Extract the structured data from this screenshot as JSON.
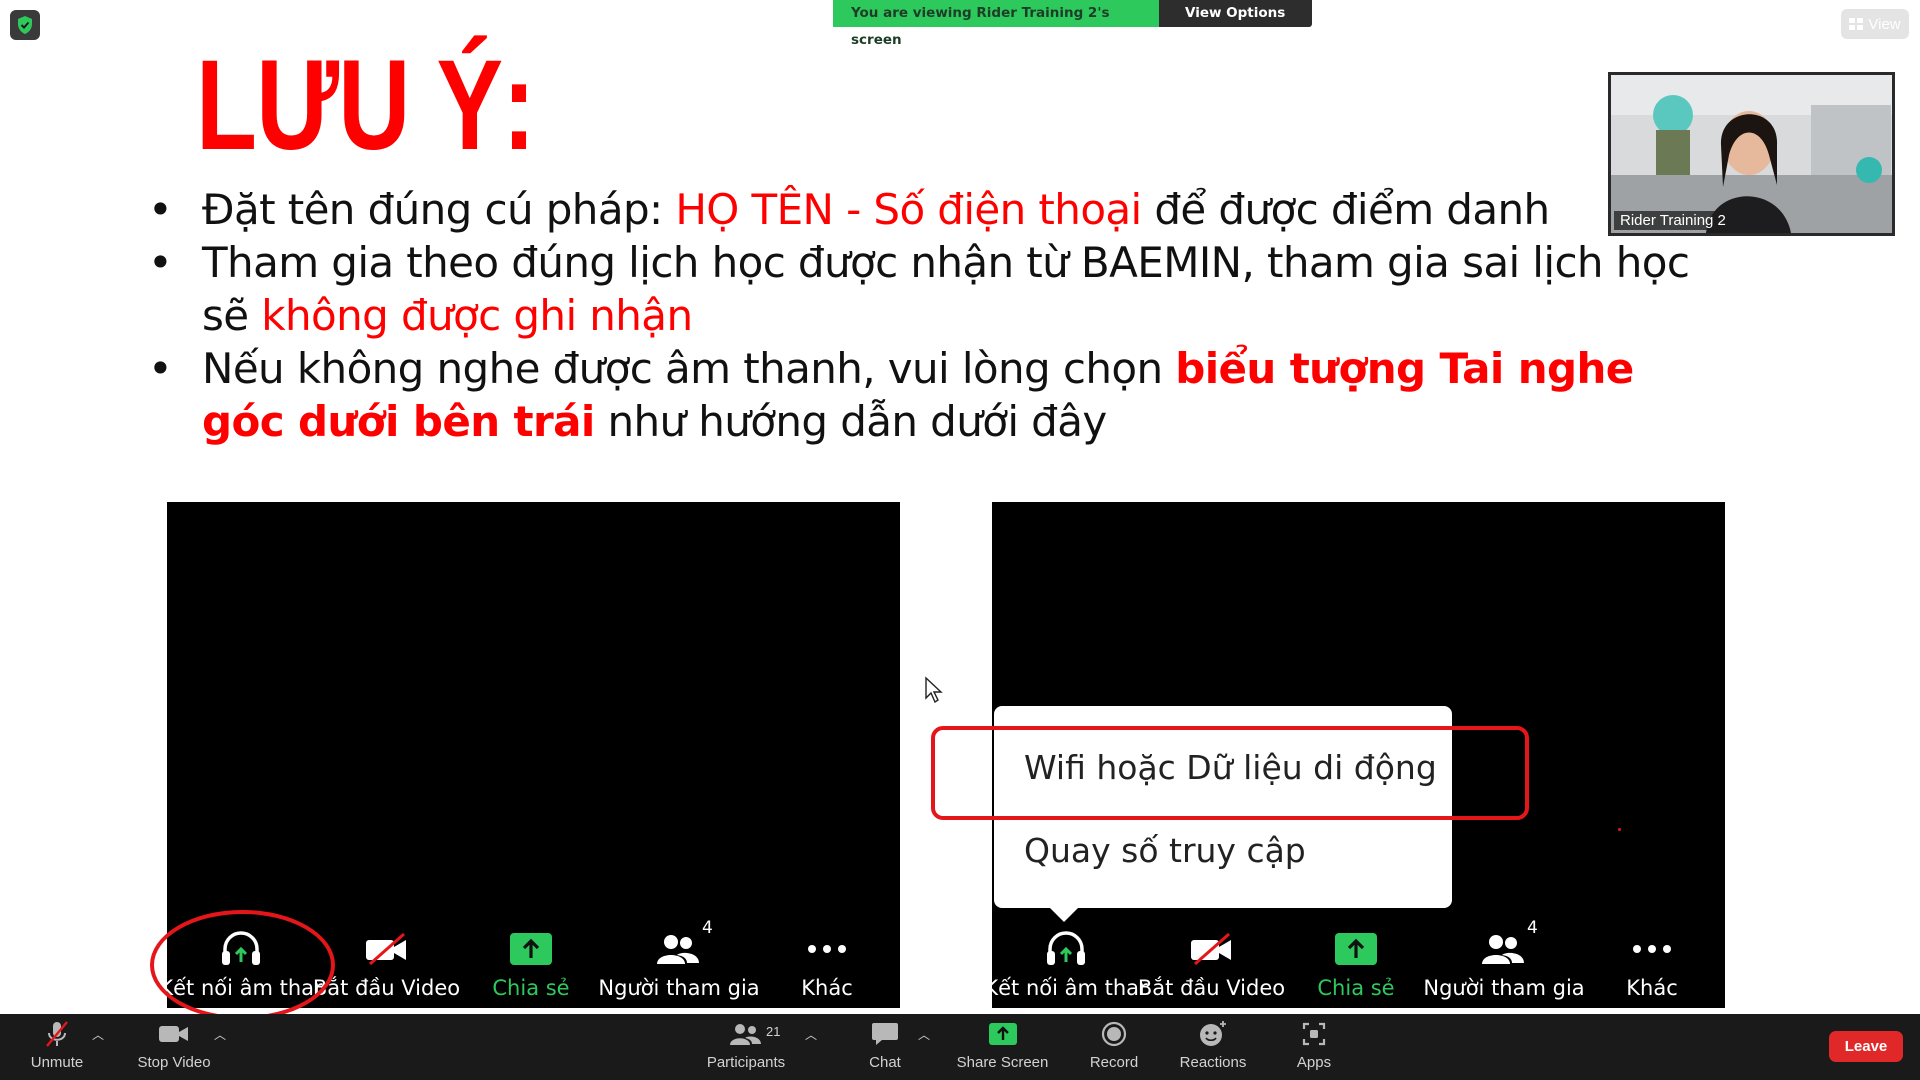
{
  "banner": {
    "viewing_text": "You are viewing Rider Training 2's screen",
    "view_options_label": "View Options",
    "view_button_label": "View"
  },
  "slide": {
    "title": "LƯU Ý:",
    "bullet1": {
      "before": "Đặt tên đúng cú pháp: ",
      "highlight": "HỌ TÊN - Số điện thoại",
      "after": " để được điểm danh"
    },
    "bullet2": {
      "before": "Tham gia theo đúng lịch học được nhận từ BAEMIN, tham gia sai lịch học sẽ ",
      "highlight": "không được ghi nhận"
    },
    "bullet3": {
      "before": "Nếu không nghe được âm thanh, vui lòng chọn ",
      "highlight": "biểu tượng Tai nghe góc dưới bên trái",
      "after": " như hướng dẫn dưới đây"
    }
  },
  "phone_toolbar": {
    "audio": "Kết nối âm thar",
    "video": "Bắt đầu Video",
    "share": "Chia sẻ",
    "participants": "Người tham gia",
    "participants_count": "4",
    "more": "Khác"
  },
  "popup": {
    "option1": "Wifi hoặc Dữ liệu di động",
    "option2": "Quay số truy cập"
  },
  "video_tile": {
    "name": "Rider Training 2"
  },
  "toolbar": {
    "unmute": "Unmute",
    "stop_video": "Stop Video",
    "participants": "Participants",
    "participants_count": "21",
    "chat": "Chat",
    "share_screen": "Share Screen",
    "record": "Record",
    "reactions": "Reactions",
    "apps": "Apps",
    "leave": "Leave"
  },
  "colors": {
    "accent_green": "#2ec95c",
    "alert_red": "#fe0000",
    "leave_red": "#e02828",
    "toolbar_bg": "#1a1a1a"
  }
}
